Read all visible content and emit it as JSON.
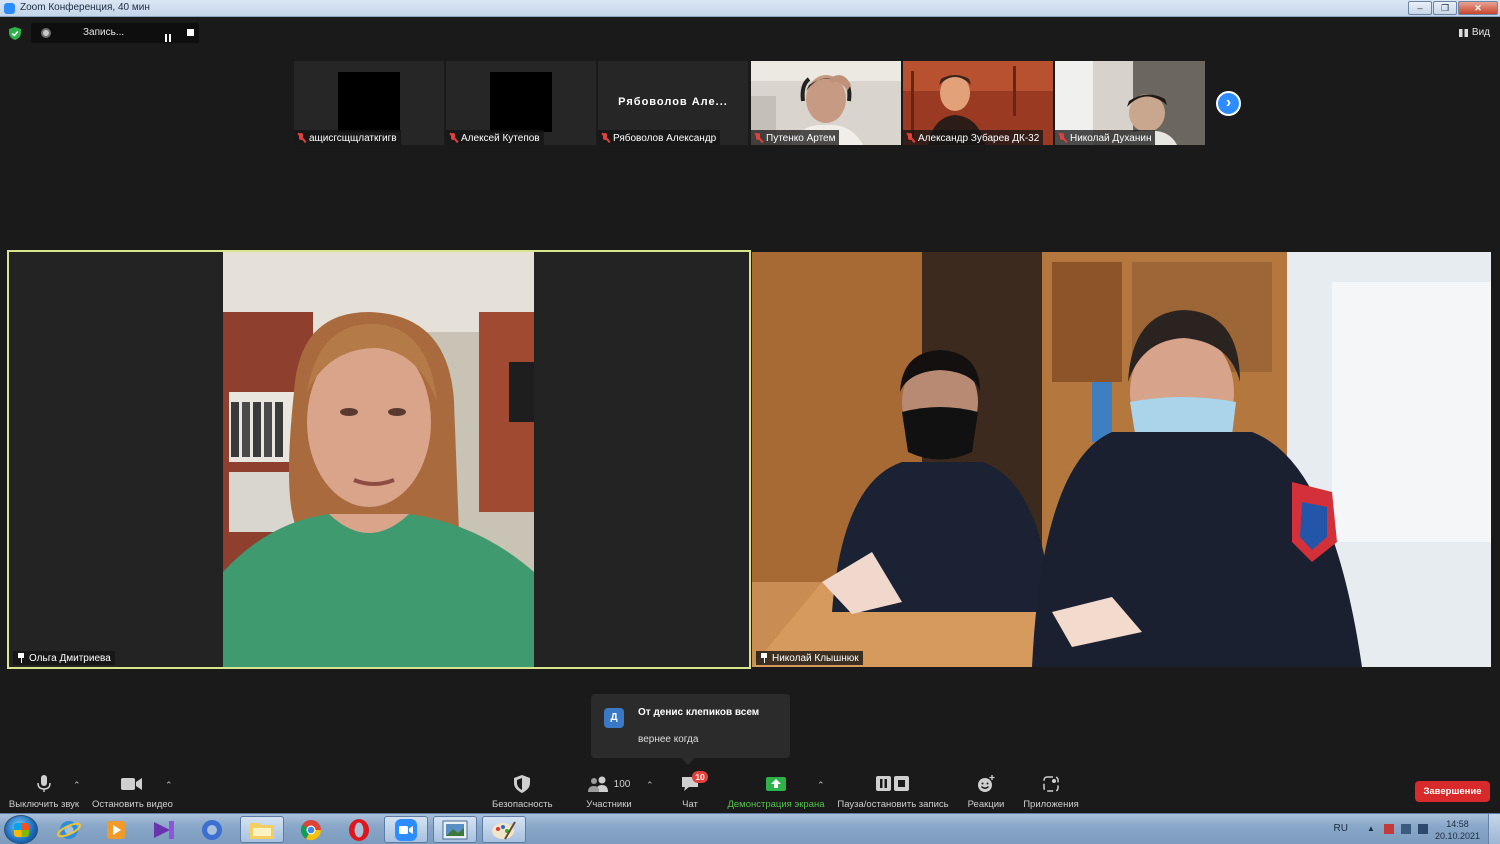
{
  "window": {
    "title": "Zoom Конференция, 40 мин",
    "buttons": [
      "–",
      "❐",
      "✕"
    ]
  },
  "topbar": {
    "recording_label": "Запись...",
    "view_label": "Вид"
  },
  "thumbnails": [
    {
      "name": "ащисгсщщлаткгигв",
      "muted": true,
      "kind": "avatar"
    },
    {
      "name": "Алексей Кутепов",
      "muted": true,
      "kind": "avatar"
    },
    {
      "name": "Рябоволов Александр",
      "muted": true,
      "kind": "name",
      "big_name": "Рябоволов Але..."
    },
    {
      "name": "Путенко Артем",
      "muted": true,
      "kind": "video"
    },
    {
      "name": "Александр Зубарев ДК-32",
      "muted": true,
      "kind": "video"
    },
    {
      "name": "Николай Духанин",
      "muted": true,
      "kind": "video"
    }
  ],
  "main": {
    "left_name": "Ольга Дмитриева",
    "right_name": "Николай Клышнюк"
  },
  "chat_toast": {
    "avatar_letter": "Д",
    "from": "От денис клепиков всем",
    "message": "вернее когда"
  },
  "toolbar": {
    "mute": "Выключить звук",
    "stop_video": "Остановить видео",
    "security": "Безопасность",
    "participants": "Участники",
    "participants_count": "100",
    "chat": "Чат",
    "chat_badge": "10",
    "share": "Демонстрация экрана",
    "pause_record": "Пауза/остановить запись",
    "reactions": "Реакции",
    "apps": "Приложения",
    "end": "Завершение"
  },
  "taskbar": {
    "lang": "RU",
    "time": "14:58",
    "date": "20.10.2021"
  },
  "colors": {
    "accent": "#2d8cff",
    "active_speaker_border": "#d9e58c",
    "end_button": "#d82a2a",
    "share_green": "#54c24d"
  }
}
